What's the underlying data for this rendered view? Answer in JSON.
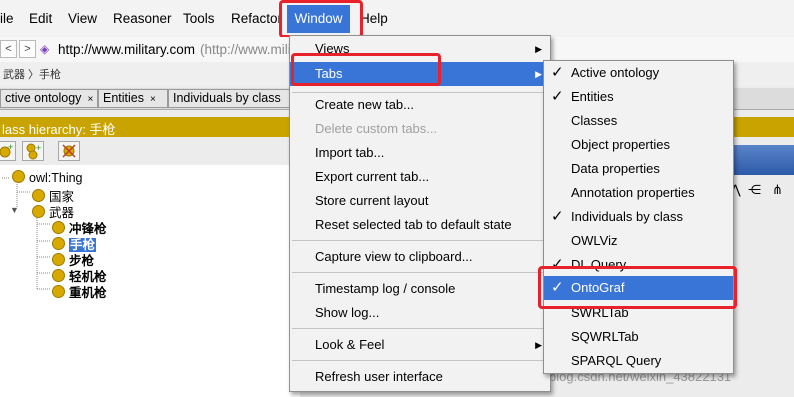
{
  "menubar": {
    "items": [
      "ile",
      "Edit",
      "View",
      "Reasoner",
      "Tools",
      "Refactor",
      "Window",
      "Help"
    ],
    "help_fragment": "Help"
  },
  "address": {
    "back": "<",
    "forward": ">",
    "url": "http://www.military.com",
    "url_hint": "(http://www.mili"
  },
  "breadcrumb": "武器 〉手枪",
  "tabs": [
    {
      "label": "ctive ontology",
      "close": "×"
    },
    {
      "label": "Entities",
      "close": "×"
    },
    {
      "label": "Individuals by class",
      "close": ""
    }
  ],
  "hierarchy_title": "lass hierarchy: 手枪",
  "tree": {
    "root": "owl:Thing",
    "children": [
      "国家",
      "武器"
    ],
    "weapons": [
      "冲锋枪",
      "手枪",
      "步枪",
      "轻机枪",
      "重机枪"
    ]
  },
  "window_menu": {
    "items": [
      {
        "label": "Views",
        "submenu": true
      },
      {
        "label": "Tabs",
        "submenu": true
      },
      {
        "label": "Create new tab..."
      },
      {
        "label": "Delete custom tabs...",
        "disabled": true
      },
      {
        "label": "Import tab..."
      },
      {
        "label": "Export current tab..."
      },
      {
        "label": "Store current layout"
      },
      {
        "label": "Reset selected tab to default state"
      },
      {
        "label": "Capture view to clipboard..."
      },
      {
        "label": "Timestamp log / console"
      },
      {
        "label": "Show log..."
      },
      {
        "label": "Look & Feel",
        "submenu": true
      },
      {
        "label": "Refresh user interface"
      }
    ]
  },
  "tabs_submenu": {
    "items": [
      {
        "label": "Active ontology",
        "checked": true
      },
      {
        "label": "Entities",
        "checked": true
      },
      {
        "label": "Classes",
        "checked": false
      },
      {
        "label": "Object properties",
        "checked": false
      },
      {
        "label": "Data properties",
        "checked": false
      },
      {
        "label": "Annotation properties",
        "checked": false
      },
      {
        "label": "Individuals by class",
        "checked": true
      },
      {
        "label": "OWLViz",
        "checked": false
      },
      {
        "label": "DL Query",
        "checked": true
      },
      {
        "label": "OntoGraf",
        "checked": true
      },
      {
        "label": "SWRLTab",
        "checked": false
      },
      {
        "label": "SQWRLTab",
        "checked": false
      },
      {
        "label": "SPARQL Query",
        "checked": false
      }
    ]
  },
  "watermark": "https://blog.csdn.net/weixin_43822131",
  "colors": {
    "highlight": "#3875d7",
    "callout": "#e8212a",
    "hierarchy_bar": "#c9a400"
  }
}
